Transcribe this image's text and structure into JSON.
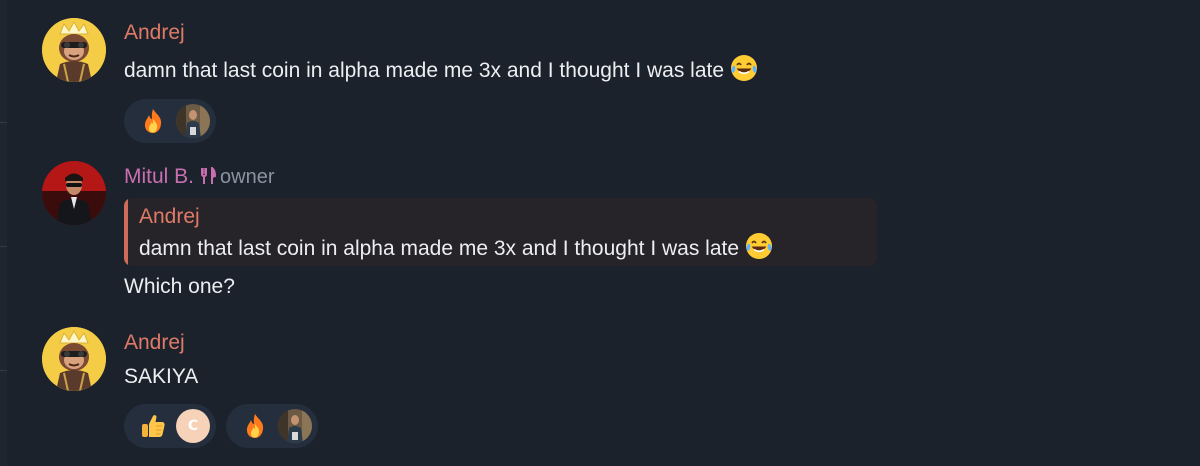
{
  "colors": {
    "background": "#1b222c",
    "name_andrej": "#e07a68",
    "name_mitul": "#c96fb0",
    "role": "#8a93a0",
    "reply_bar": "#d06a5b",
    "reaction_bg": "#242e3d"
  },
  "messages": [
    {
      "author": "Andrej",
      "avatar_icon": "ape-avatar-icon",
      "text": "damn that last coin in alpha made me 3x and I thought I was late",
      "text_emoji": "laughing-tears-emoji",
      "reactions": [
        {
          "emoji": "fire-emoji",
          "user": "photo-avatar"
        }
      ]
    },
    {
      "author": "Mitul B.",
      "avatar_icon": "man-photo-avatar-icon",
      "badge_icon": "fork-knife-icon",
      "role": "owner",
      "reply": {
        "author": "Andrej",
        "text": "damn that last coin in alpha made me 3x and I thought I was late",
        "text_emoji": "laughing-tears-emoji"
      },
      "text": "Which one?"
    },
    {
      "author": "Andrej",
      "avatar_icon": "ape-avatar-icon",
      "text": "SAKIYA",
      "reactions": [
        {
          "emoji": "thumbs-up-emoji",
          "user_letter": "C"
        },
        {
          "emoji": "fire-emoji",
          "user": "photo-avatar"
        }
      ]
    }
  ]
}
